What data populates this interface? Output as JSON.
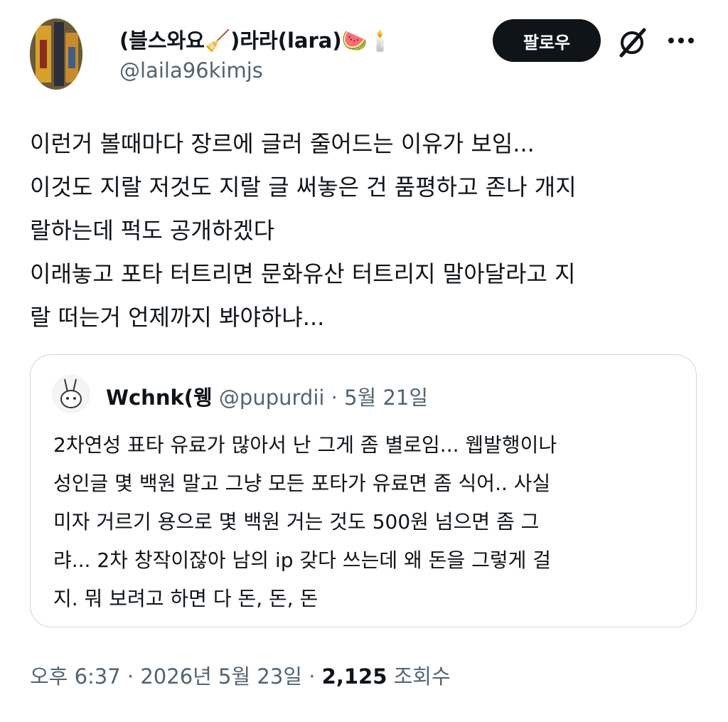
{
  "author": {
    "display_name": "(블스와요🧹)라라(lara)🍉🕯️",
    "handle": "@laila96kimjs"
  },
  "actions": {
    "follow_label": "팔로우",
    "grok_icon": "grok-slash-icon",
    "more_icon": "more-dots-icon"
  },
  "tweet": {
    "lines": [
      "이런거 볼때마다 장르에 글러 줄어드는 이유가 보임...",
      "이것도 지랄 저것도 지랄 글 써놓은 건 품평하고 존나 개지",
      "랄하는데 퍽도 공개하겠다",
      "이래놓고 포타 터트리면 문화유산 터트리지 말아달라고 지",
      "랄 떠는거 언제까지 봐야하냐..."
    ]
  },
  "quote": {
    "display_name": "Wchnk(웽",
    "handle": "@pupurdii",
    "separator": "·",
    "date": "5월 21일",
    "lines": [
      "2차연성 표타 유료가 많아서 난 그게 좀 별로임... 웹발행이나",
      "성인글 몇 백원 말고 그냥 모든 포타가 유료면 좀 식어.. 사실",
      "미자 거르기 용으로 몇 백원 거는 것도 500원 넘으면 좀 그",
      "랴... 2차 창작이잖아 남의 ip 갖다 쓰는데 왜 돈을 그렇게 걸",
      "지. 뭐 보려고 하면 다 돈, 돈, 돈"
    ]
  },
  "meta": {
    "time": "오후 6:37",
    "sep1": "·",
    "date": "2026년 5월 23일",
    "sep2": "·",
    "views": "2,125",
    "views_label": "조회수"
  }
}
